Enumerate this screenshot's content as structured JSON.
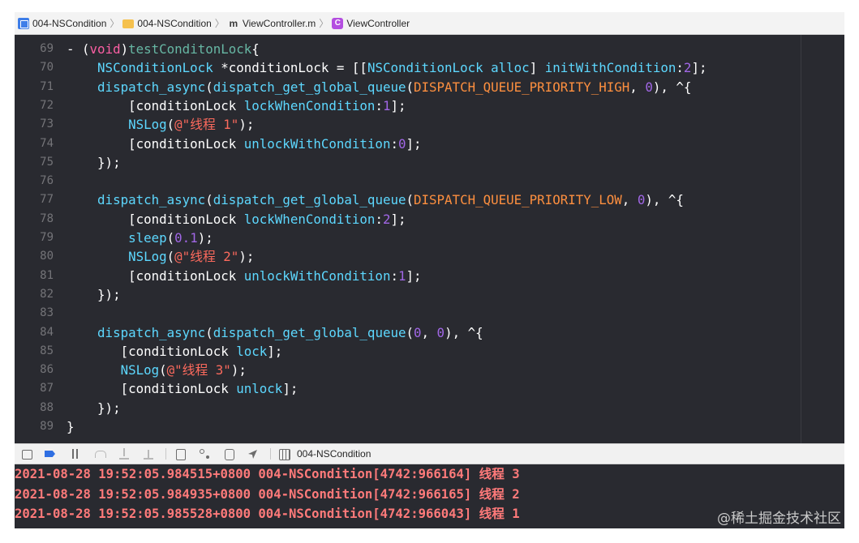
{
  "jumpbar": {
    "crumbs": [
      {
        "label": "004-NSCondition",
        "icon": "xcode-project-icon"
      },
      {
        "label": "004-NSCondition",
        "icon": "folder-icon"
      },
      {
        "label": "ViewController.m",
        "icon": "objc-file-icon",
        "icon_glyph": "m"
      },
      {
        "label": "ViewController",
        "icon": "class-icon",
        "icon_glyph": "C"
      }
    ]
  },
  "editor": {
    "line_numbers": [
      "69",
      "70",
      "71",
      "72",
      "73",
      "74",
      "75",
      "76",
      "77",
      "78",
      "79",
      "80",
      "81",
      "82",
      "83",
      "84",
      "85",
      "86",
      "87",
      "88",
      "89"
    ],
    "lines": [
      [
        [
          "",
          "- ("
        ],
        [
          "kw",
          "void"
        ],
        [
          "",
          ")"
        ],
        [
          "fn",
          "testConditonLock"
        ],
        [
          "",
          "{"
        ]
      ],
      [
        [
          "",
          "    "
        ],
        [
          "cls",
          "NSConditionLock"
        ],
        [
          "",
          " *conditionLock = [["
        ],
        [
          "cls",
          "NSConditionLock"
        ],
        [
          "tc",
          " alloc"
        ],
        [
          "",
          "] "
        ],
        [
          "tc",
          "initWithCondition"
        ],
        [
          "",
          ":"
        ],
        [
          "num2",
          "2"
        ],
        [
          "",
          "];"
        ]
      ],
      [
        [
          "",
          "    "
        ],
        [
          "cls",
          "dispatch_async"
        ],
        [
          "",
          "("
        ],
        [
          "cls",
          "dispatch_get_global_queue"
        ],
        [
          "",
          "("
        ],
        [
          "mac",
          "DISPATCH_QUEUE_PRIORITY_HIGH"
        ],
        [
          "",
          ", "
        ],
        [
          "num2",
          "0"
        ],
        [
          "",
          "), ^{"
        ]
      ],
      [
        [
          "",
          "        [conditionLock "
        ],
        [
          "tc",
          "lockWhenCondition"
        ],
        [
          "",
          ":"
        ],
        [
          "num2",
          "1"
        ],
        [
          "",
          "];"
        ]
      ],
      [
        [
          "",
          "        "
        ],
        [
          "cls",
          "NSLog"
        ],
        [
          "",
          "("
        ],
        [
          "str",
          "@\"线程 1\""
        ],
        [
          "",
          ");"
        ]
      ],
      [
        [
          "",
          "        [conditionLock "
        ],
        [
          "tc",
          "unlockWithCondition"
        ],
        [
          "",
          ":"
        ],
        [
          "num2",
          "0"
        ],
        [
          "",
          "];"
        ]
      ],
      [
        [
          "",
          "    });"
        ]
      ],
      [
        [
          "",
          ""
        ]
      ],
      [
        [
          "",
          "    "
        ],
        [
          "cls",
          "dispatch_async"
        ],
        [
          "",
          "("
        ],
        [
          "cls",
          "dispatch_get_global_queue"
        ],
        [
          "",
          "("
        ],
        [
          "mac",
          "DISPATCH_QUEUE_PRIORITY_LOW"
        ],
        [
          "",
          ", "
        ],
        [
          "num2",
          "0"
        ],
        [
          "",
          "), ^{"
        ]
      ],
      [
        [
          "",
          "        [conditionLock "
        ],
        [
          "tc",
          "lockWhenCondition"
        ],
        [
          "",
          ":"
        ],
        [
          "num2",
          "2"
        ],
        [
          "",
          "];"
        ]
      ],
      [
        [
          "",
          "        "
        ],
        [
          "cls",
          "sleep"
        ],
        [
          "",
          "("
        ],
        [
          "num2",
          "0.1"
        ],
        [
          "",
          ");"
        ]
      ],
      [
        [
          "",
          "        "
        ],
        [
          "cls",
          "NSLog"
        ],
        [
          "",
          "("
        ],
        [
          "str",
          "@\"线程 2\""
        ],
        [
          "",
          ");"
        ]
      ],
      [
        [
          "",
          "        [conditionLock "
        ],
        [
          "tc",
          "unlockWithCondition"
        ],
        [
          "",
          ":"
        ],
        [
          "num2",
          "1"
        ],
        [
          "",
          "];"
        ]
      ],
      [
        [
          "",
          "    });"
        ]
      ],
      [
        [
          "",
          ""
        ]
      ],
      [
        [
          "",
          "    "
        ],
        [
          "cls",
          "dispatch_async"
        ],
        [
          "",
          "("
        ],
        [
          "cls",
          "dispatch_get_global_queue"
        ],
        [
          "",
          "("
        ],
        [
          "num2",
          "0"
        ],
        [
          "",
          ", "
        ],
        [
          "num2",
          "0"
        ],
        [
          "",
          "), ^{"
        ]
      ],
      [
        [
          "",
          "       [conditionLock "
        ],
        [
          "tc",
          "lock"
        ],
        [
          "",
          "];"
        ]
      ],
      [
        [
          "",
          "       "
        ],
        [
          "cls",
          "NSLog"
        ],
        [
          "",
          "("
        ],
        [
          "str",
          "@\"线程 3\""
        ],
        [
          "",
          ");"
        ]
      ],
      [
        [
          "",
          "       [conditionLock "
        ],
        [
          "tc",
          "unlock"
        ],
        [
          "",
          "];"
        ]
      ],
      [
        [
          "",
          "    });"
        ]
      ],
      [
        [
          "",
          "}"
        ]
      ]
    ]
  },
  "debugbar": {
    "target_label": "004-NSCondition"
  },
  "console": {
    "lines": [
      "2021-08-28 19:52:05.984515+0800 004-NSCondition[4742:966164] 线程 3",
      "2021-08-28 19:52:05.984935+0800 004-NSCondition[4742:966165] 线程 2",
      "2021-08-28 19:52:05.985528+0800 004-NSCondition[4742:966043] 线程 1"
    ]
  },
  "watermark": "@稀土掘金技术社区",
  "colors": {
    "editor_bg": "#292a30",
    "keyword": "#fc5fa3",
    "type": "#5dd8ff",
    "string": "#fc6a5d",
    "number": "#a167e6",
    "macro": "#fd8f3f",
    "console_text": "#ff7a7a"
  }
}
